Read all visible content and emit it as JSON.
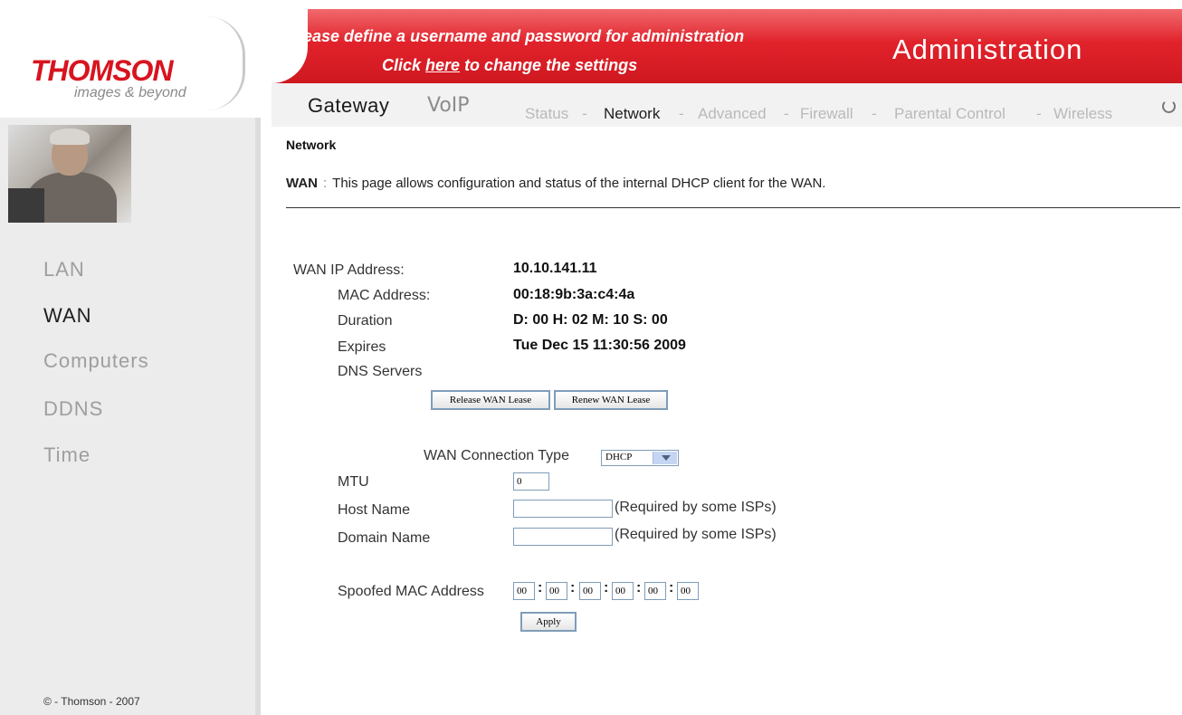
{
  "logo": {
    "brand": "THOMSON",
    "tagline": "images & beyond"
  },
  "banner": {
    "line1": "Please define a username and password for administration",
    "line2_prefix": "Click ",
    "line2_link": "here",
    "line2_suffix": " to change the settings",
    "section_title": "Administration"
  },
  "nav": {
    "main_tabs": [
      "Gateway",
      "VoIP"
    ],
    "sub_tabs": [
      "Status",
      "Network",
      "Advanced",
      "Firewall",
      "Parental Control",
      "Wireless"
    ],
    "separator": "-"
  },
  "sidebar": {
    "items": [
      "LAN",
      "WAN",
      "Computers",
      "DDNS",
      "Time"
    ],
    "active": "WAN",
    "copyright": "© - Thomson - 2007"
  },
  "page": {
    "title": "Network",
    "section_label": "WAN",
    "section_colon": ":",
    "description": "This page allows configuration and status of the internal DHCP client for the WAN."
  },
  "wan_status": {
    "ip_label": "WAN IP Address:",
    "ip_value": "10.10.141.11",
    "mac_label": "MAC Address:",
    "mac_value": "00:18:9b:3a:c4:4a",
    "duration_label": "Duration",
    "duration_value": "D: 00 H: 02 M: 10 S: 00",
    "expires_label": "Expires",
    "expires_value": "Tue Dec 15 11:30:56 2009",
    "dns_label": "DNS Servers"
  },
  "buttons": {
    "release": "Release WAN Lease",
    "renew": "Renew WAN Lease",
    "apply": "Apply"
  },
  "config": {
    "conn_type_label": "WAN Connection Type",
    "conn_type_value": "DHCP",
    "mtu_label": "MTU",
    "mtu_value": "0",
    "host_label": "Host Name",
    "host_value": "",
    "host_note": "(Required by some ISPs)",
    "domain_label": "Domain Name",
    "domain_value": "",
    "domain_note": "(Required by some ISPs)",
    "spoof_label": "Spoofed MAC Address",
    "spoof_octets": [
      "00",
      "00",
      "00",
      "00",
      "00",
      "00"
    ],
    "spoof_sep": ":"
  },
  "colors": {
    "brand_red": "#e1222b",
    "text_dark": "#1b1b1b",
    "text_muted": "#9e9e9e"
  }
}
